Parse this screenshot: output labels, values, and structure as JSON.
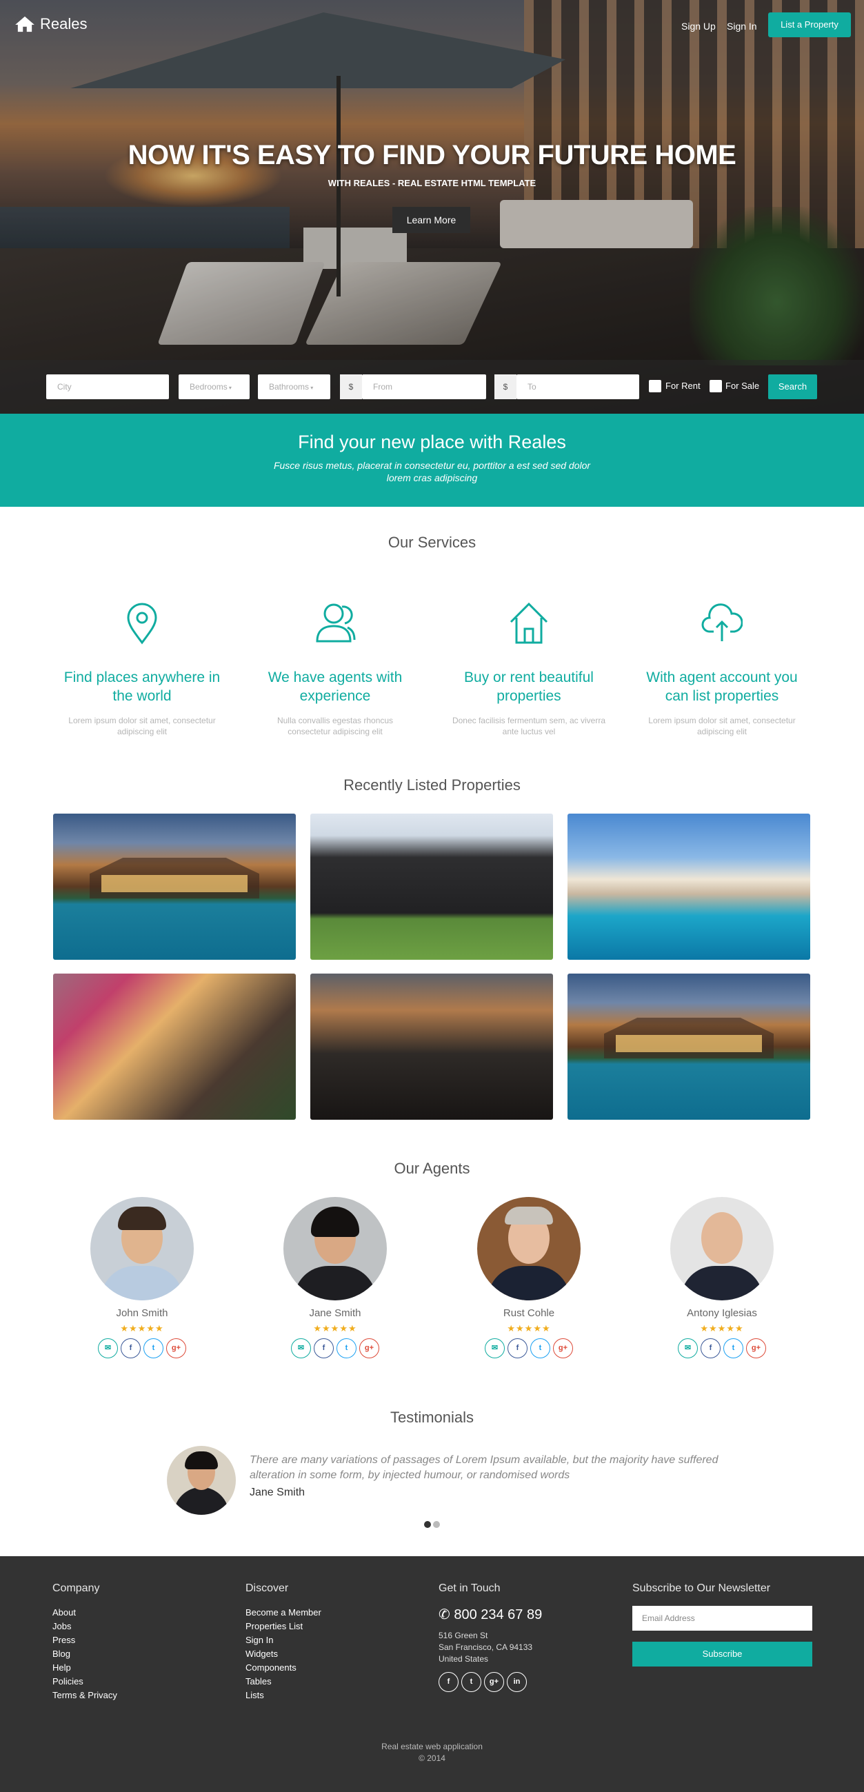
{
  "nav": {
    "logo_text": "Reales",
    "links": [
      "Sign Up",
      "Sign In"
    ],
    "cta": "List a Property"
  },
  "hero": {
    "title": "NOW IT'S EASY TO FIND YOUR FUTURE HOME",
    "subtitle": "WITH REALES - REAL ESTATE HTML TEMPLATE",
    "button": "Learn More"
  },
  "search": {
    "city_placeholder": "City",
    "bedrooms": "Bedrooms",
    "bathrooms": "Bathrooms",
    "currency": "$",
    "from_placeholder": "From",
    "to_placeholder": "To",
    "for_rent": "For Rent",
    "for_sale": "For Sale",
    "button": "Search"
  },
  "band": {
    "title": "Find your new place with Reales",
    "text": "Fusce risus metus, placerat in consectetur eu, porttitor a est sed sed dolor lorem cras adipiscing"
  },
  "services": {
    "title": "Our Services",
    "items": [
      {
        "icon": "map-pin-icon",
        "title": "Find places anywhere in the world",
        "text": "Lorem ipsum dolor sit amet, consectetur adipiscing elit"
      },
      {
        "icon": "users-icon",
        "title": "We have agents with experience",
        "text": "Nulla convallis egestas rhoncus consectetur adipiscing elit"
      },
      {
        "icon": "home-icon",
        "title": "Buy or rent beautiful properties",
        "text": "Donec facilisis fermentum sem, ac viverra ante luctus vel"
      },
      {
        "icon": "cloud-upload-icon",
        "title": "With agent account you can list properties",
        "text": "Lorem ipsum dolor sit amet, consectetur adipiscing elit"
      }
    ]
  },
  "properties": {
    "title": "Recently Listed Properties"
  },
  "agents": {
    "title": "Our Agents",
    "items": [
      {
        "name": "John Smith",
        "rating": 5
      },
      {
        "name": "Jane Smith",
        "rating": 5
      },
      {
        "name": "Rust Cohle",
        "rating": 5
      },
      {
        "name": "Antony Iglesias",
        "rating": 5
      }
    ]
  },
  "testimonials": {
    "title": "Testimonials",
    "quote": "There are many variations of passages of Lorem Ipsum available, but the majority have suffered alteration in some form, by injected humour, or randomised words",
    "author": "Jane Smith"
  },
  "footer": {
    "company": {
      "title": "Company",
      "links": [
        "About",
        "Jobs",
        "Press",
        "Blog",
        "Help",
        "Policies",
        "Terms & Privacy"
      ]
    },
    "discover": {
      "title": "Discover",
      "links": [
        "Become a Member",
        "Properties List",
        "Sign In",
        "Widgets",
        "Components",
        "Tables",
        "Lists"
      ]
    },
    "contact": {
      "title": "Get in Touch",
      "phone": "800 234 67 89",
      "address": [
        "516 Green St",
        "San Francisco, CA 94133",
        "United States"
      ]
    },
    "newsletter": {
      "title": "Subscribe to Our Newsletter",
      "placeholder": "Email Address",
      "button": "Subscribe"
    },
    "copyright": [
      "Real estate web application",
      "© 2014"
    ]
  },
  "colors": {
    "accent": "#10aca0",
    "footer_bg": "#333333",
    "star": "#f0ad1e"
  }
}
